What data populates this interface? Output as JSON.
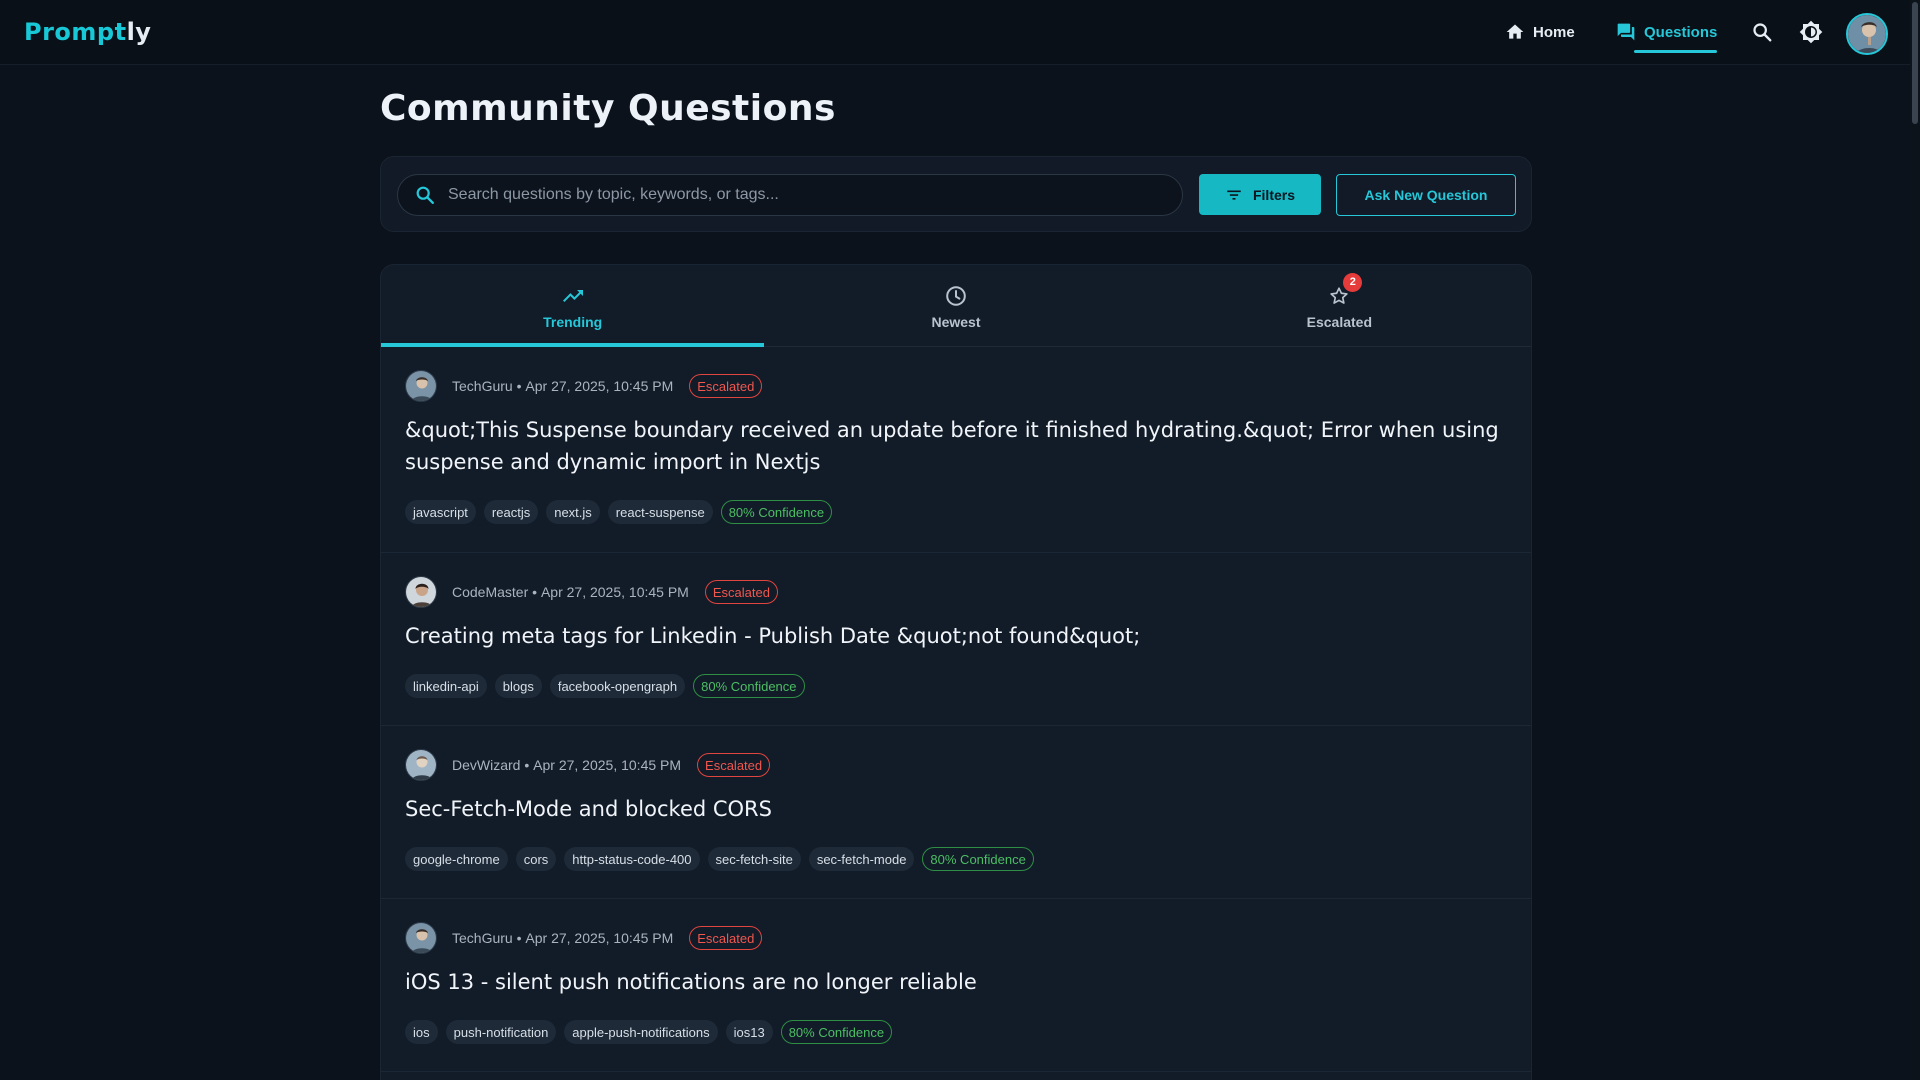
{
  "app": {
    "logo_part1": "Prompt",
    "logo_part2": "ly"
  },
  "nav": {
    "home": "Home",
    "questions": "Questions"
  },
  "page": {
    "title": "Community Questions"
  },
  "search": {
    "placeholder": "Search questions by topic, keywords, or tags...",
    "filters_label": "Filters",
    "ask_label": "Ask New Question"
  },
  "tabs": [
    {
      "label": "Trending",
      "icon": "trending-up-icon",
      "active": true
    },
    {
      "label": "Newest",
      "icon": "clock-icon",
      "active": false
    },
    {
      "label": "Escalated",
      "icon": "star-icon",
      "active": false,
      "badge": "2"
    }
  ],
  "colors": {
    "accent": "#25c7d8",
    "escalated": "#f0574f",
    "confidence": "#4cbe64",
    "badge": "#e53b3b"
  },
  "questions": [
    {
      "author": "TechGuru",
      "date": "Apr 27, 2025, 10:45 PM",
      "status": "Escalated",
      "title": "&quot;This Suspense boundary received an update before it finished hydrating.&quot; Error when using suspense and dynamic import in Nextjs",
      "tags": [
        "javascript",
        "reactjs",
        "next.js",
        "react-suspense"
      ],
      "confidence": "80% Confidence"
    },
    {
      "author": "CodeMaster",
      "date": "Apr 27, 2025, 10:45 PM",
      "status": "Escalated",
      "title": "Creating meta tags for Linkedin - Publish Date &quot;not found&quot;",
      "tags": [
        "linkedin-api",
        "blogs",
        "facebook-opengraph"
      ],
      "confidence": "80% Confidence"
    },
    {
      "author": "DevWizard",
      "date": "Apr 27, 2025, 10:45 PM",
      "status": "Escalated",
      "title": "Sec-Fetch-Mode and blocked CORS",
      "tags": [
        "google-chrome",
        "cors",
        "http-status-code-400",
        "sec-fetch-site",
        "sec-fetch-mode"
      ],
      "confidence": "80% Confidence"
    },
    {
      "author": "TechGuru",
      "date": "Apr 27, 2025, 10:45 PM",
      "status": "Escalated",
      "title": "iOS 13 - silent push notifications are no longer reliable",
      "tags": [
        "ios",
        "push-notification",
        "apple-push-notifications",
        "ios13"
      ],
      "confidence": "80% Confidence"
    }
  ]
}
